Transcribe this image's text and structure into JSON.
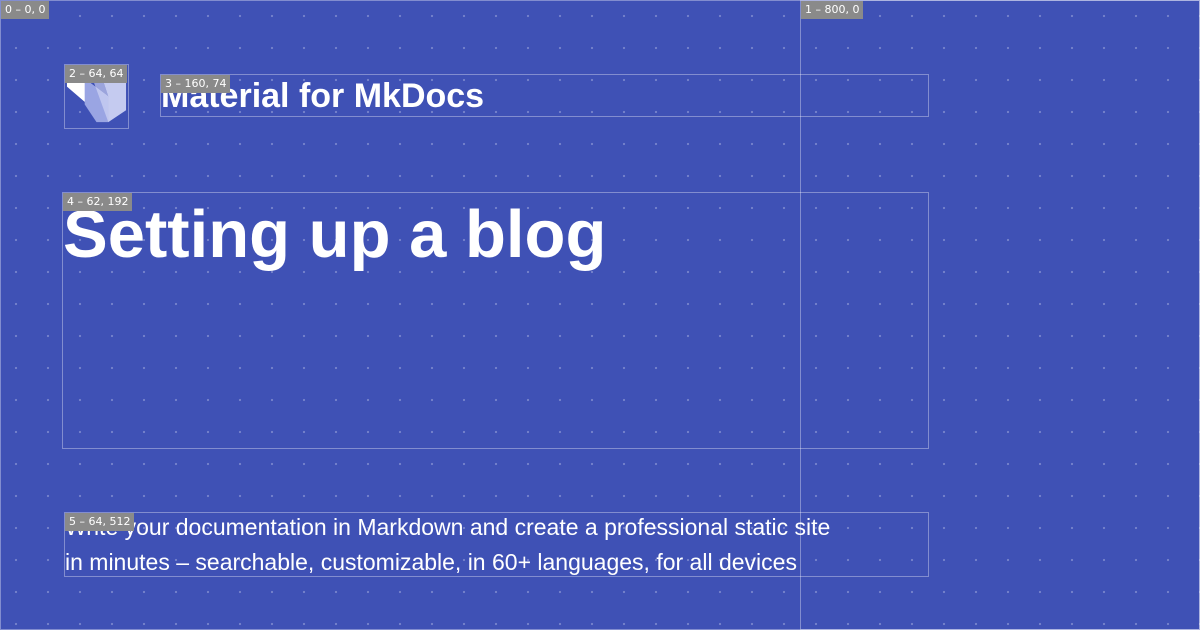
{
  "debug_labels": [
    "0 – 0, 0",
    "1 – 800, 0",
    "2 – 64, 64",
    "3 – 160, 74",
    "4 – 62, 192",
    "5 – 64, 512"
  ],
  "site": {
    "name": "Material for MkDocs",
    "logo_icon": "material-logo-icon"
  },
  "page": {
    "title": "Setting up a blog",
    "description_lines": [
      "Write your documentation in Markdown and create a professional static site",
      "in minutes – searchable, customizable, in 60+ languages, for all devices"
    ]
  },
  "colors": {
    "background": "#3f51b5",
    "text": "#ffffff",
    "label_background": "#8a8a8a"
  }
}
